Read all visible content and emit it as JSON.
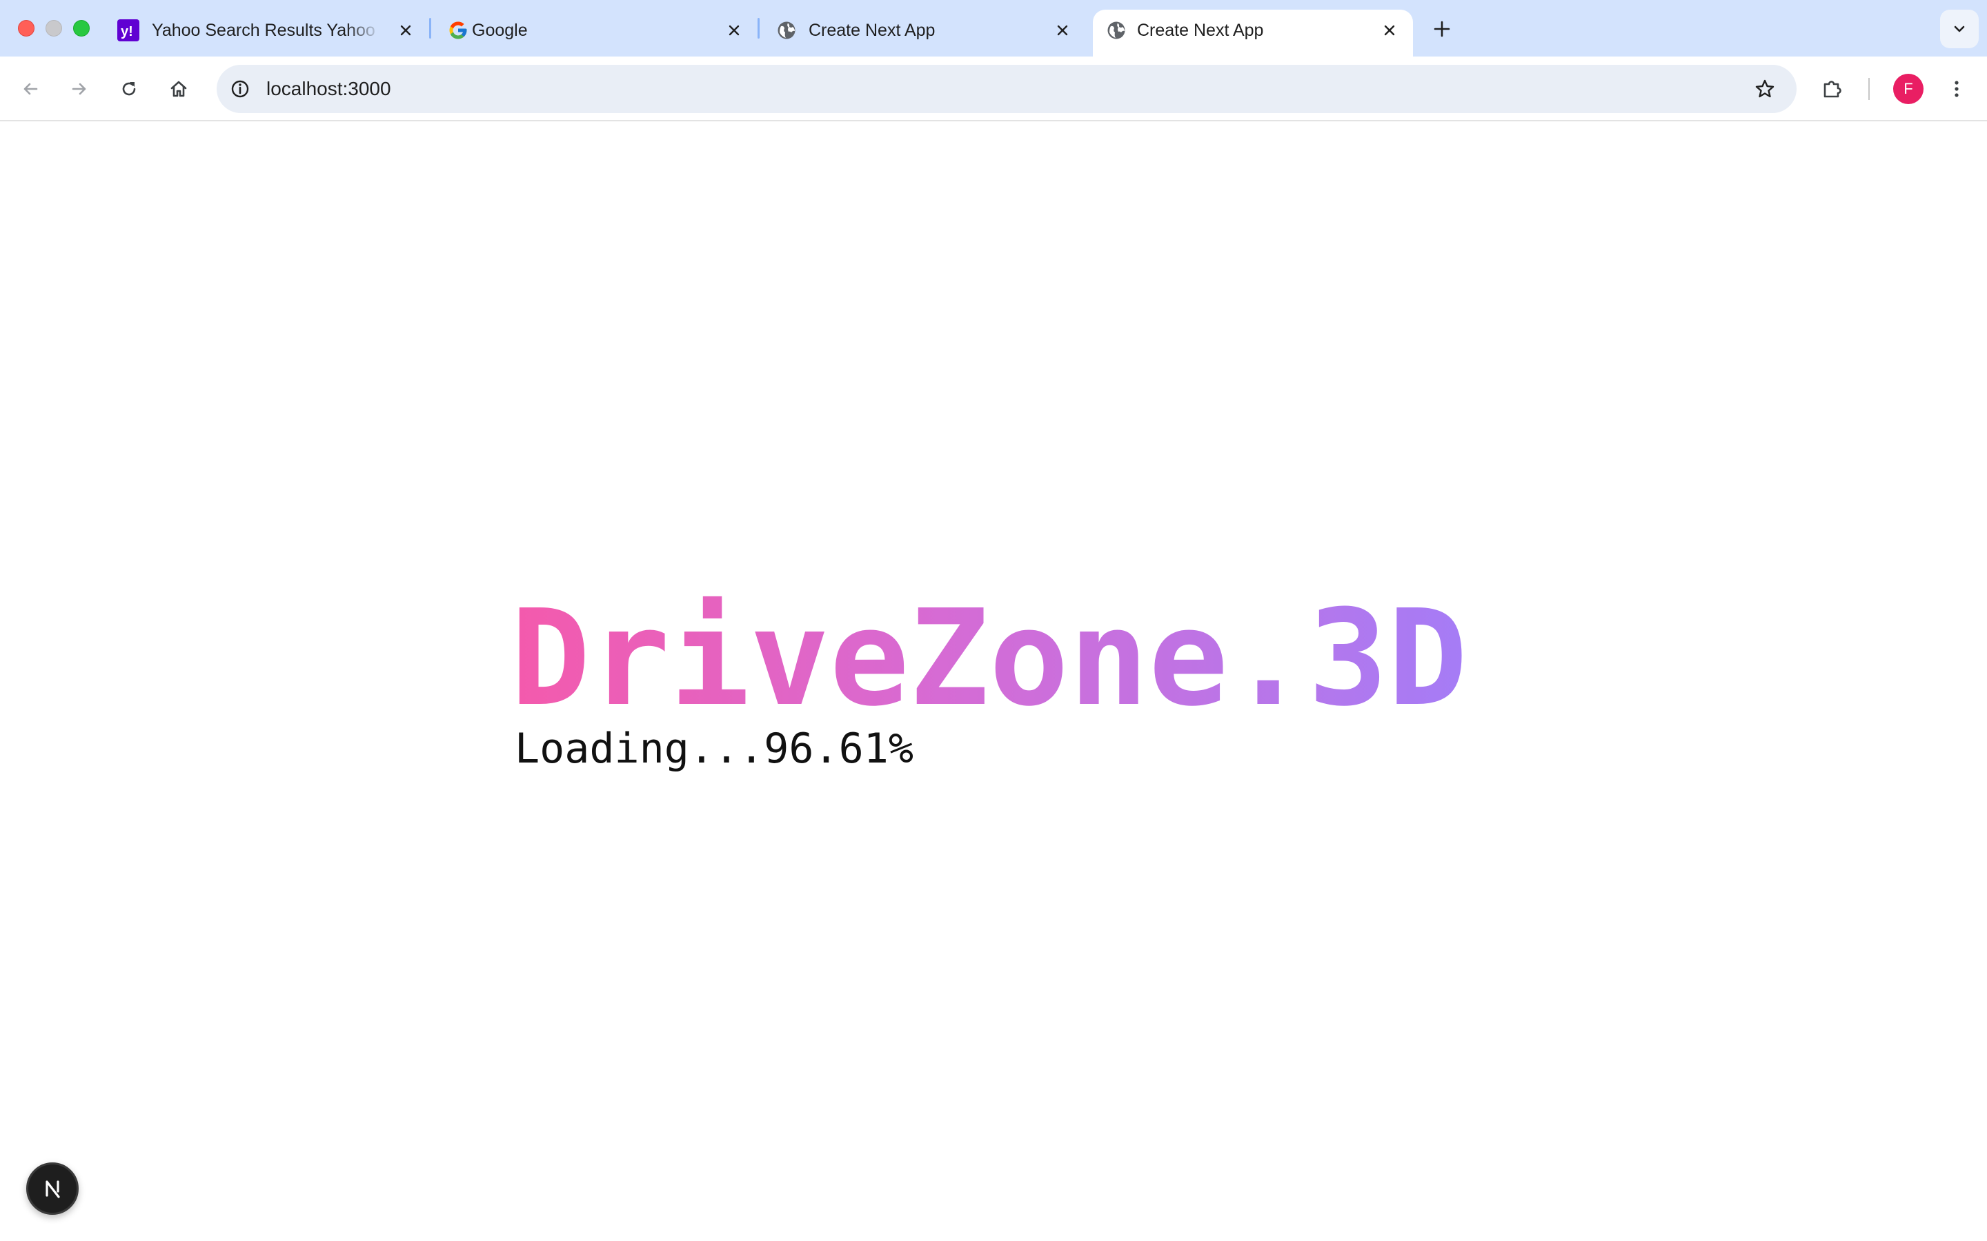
{
  "browser": {
    "tabs": [
      {
        "title": "Yahoo Search Results Yahoo Search Results",
        "favicon": "yahoo-icon",
        "active": false
      },
      {
        "title": "Google",
        "favicon": "google-icon",
        "active": false
      },
      {
        "title": "Create Next App",
        "favicon": "globe-icon",
        "active": false
      },
      {
        "title": "Create Next App",
        "favicon": "globe-icon",
        "active": true
      }
    ],
    "address_bar": {
      "url": "localhost:3000"
    },
    "profile_initial": "F",
    "colors": {
      "tabstrip": "#d3e3fd",
      "profile": "#e91e63",
      "yahoo": "#6001d2"
    }
  },
  "page": {
    "brand_title": "DriveZone.3D",
    "loading_text": "Loading...96.61%",
    "loading_progress_percent": 96.61,
    "gradient_colors": [
      "#f45aac",
      "#d66bd4",
      "#a57cf6"
    ],
    "dev_badge_letter": "N"
  }
}
